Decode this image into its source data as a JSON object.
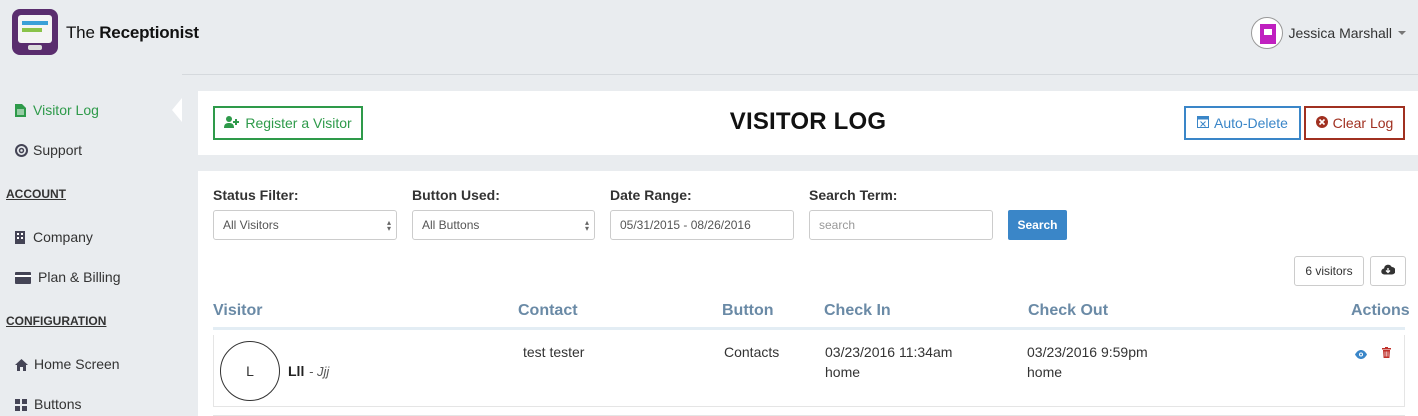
{
  "app": {
    "brand_prefix": "The",
    "brand_name": "Receptionist",
    "user_name": "Jessica Marshall"
  },
  "sidebar": {
    "items": [
      {
        "label": "Visitor Log",
        "icon": "file-text-icon",
        "active": true
      },
      {
        "label": "Support",
        "icon": "life-ring-icon"
      }
    ],
    "account_heading": "ACCOUNT",
    "account_items": [
      {
        "label": "Company",
        "icon": "building-icon"
      },
      {
        "label": "Plan & Billing",
        "icon": "credit-card-icon"
      }
    ],
    "config_heading": "CONFIGURATION",
    "config_items": [
      {
        "label": "Home Screen",
        "icon": "home-icon"
      },
      {
        "label": "Buttons",
        "icon": "grid-icon"
      }
    ]
  },
  "header": {
    "title": "VISITOR LOG",
    "register_label": "Register a Visitor",
    "autodelete_label": "Auto-Delete",
    "clear_label": "Clear Log"
  },
  "filters": {
    "status_label": "Status Filter:",
    "status_value": "All Visitors",
    "button_label": "Button Used:",
    "button_value": "All Buttons",
    "date_label": "Date Range:",
    "date_value": "05/31/2015 - 08/26/2016",
    "search_label": "Search Term:",
    "search_placeholder": "search",
    "search_button": "Search"
  },
  "summary": {
    "count_label": "6 visitors"
  },
  "table": {
    "columns": [
      "Visitor",
      "Contact",
      "Button",
      "Check In",
      "Check Out",
      "Actions"
    ],
    "rows": [
      {
        "avatar_initial": "L",
        "visitor_name": "Lll",
        "visitor_extra": "- Jjj",
        "contact": "test tester",
        "button": "Contacts",
        "check_in_time": "03/23/2016 11:34am",
        "check_in_location": "home",
        "check_out_time": "03/23/2016 9:59pm",
        "check_out_location": "home"
      }
    ]
  },
  "colors": {
    "green": "#2e9a4a",
    "blue": "#3a86c8",
    "red": "#a03020",
    "header_text": "#6a8aa6"
  }
}
